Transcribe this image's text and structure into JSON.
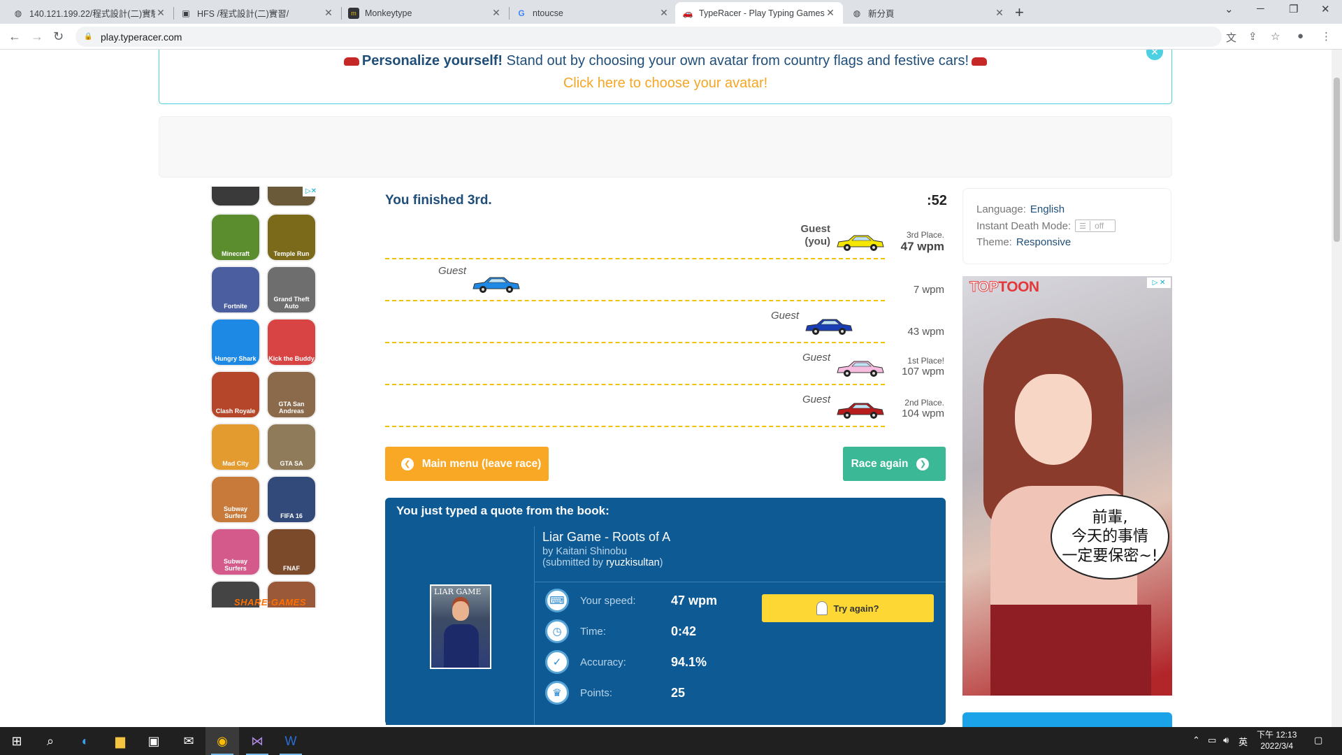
{
  "browser": {
    "tabs": [
      {
        "title": "140.121.199.22/程式設計(二)實驗",
        "icon": "globe-icon"
      },
      {
        "title": "HFS /程式設計(二)實習/",
        "icon": "hfs-icon"
      },
      {
        "title": "Monkeytype",
        "icon": "monkeytype-icon"
      },
      {
        "title": "ntoucse",
        "icon": "google-icon"
      },
      {
        "title": "TypeRacer - Play Typing Games",
        "icon": "typeracer-icon",
        "active": true
      },
      {
        "title": "新分頁",
        "icon": "globe-icon"
      }
    ],
    "url": "play.typeracer.com"
  },
  "banner": {
    "bold": "Personalize yourself!",
    "text": " Stand out by choosing your own avatar from country flags and festive cars!",
    "link": "Click here to choose your avatar!"
  },
  "game_ad": {
    "games": [
      "Minecraft",
      "Temple Run",
      "Fortnite",
      "Grand Theft Auto",
      "Hungry Shark",
      "Kick the Buddy",
      "Clash Royale",
      "GTA San Andreas",
      "Mad City",
      "GTA SA",
      "Subway Surfers",
      "FIFA 16",
      "Subway Surfers",
      "FNAF"
    ],
    "footer": "SHARE·GAMES"
  },
  "race": {
    "finish_message": "You finished 3rd.",
    "timer": ":52",
    "lanes": [
      {
        "name": "Guest",
        "sub": "(you)",
        "you": true,
        "place_label": "3rd Place.",
        "wpm": "47 wpm",
        "car_color": "#f5e600",
        "progress": 1.0
      },
      {
        "name": "Guest",
        "you": false,
        "place_label": "",
        "wpm": "7 wpm",
        "car_color": "#1e88e5",
        "progress": 0.19
      },
      {
        "name": "Guest",
        "you": false,
        "place_label": "",
        "wpm": "43 wpm",
        "car_color": "#1a3fb5",
        "progress": 0.93
      },
      {
        "name": "Guest",
        "you": false,
        "place_label": "1st Place!",
        "wpm": "107 wpm",
        "car_color": "#f6bde0",
        "progress": 1.0
      },
      {
        "name": "Guest",
        "you": false,
        "place_label": "2nd Place.",
        "wpm": "104 wpm",
        "car_color": "#b71c1c",
        "progress": 1.0
      }
    ],
    "main_menu_label": "Main menu (leave race)",
    "race_again_label": "Race again"
  },
  "quote": {
    "header": "You just typed a quote from the book:",
    "cover_text": "LIAR GAME",
    "book_title": "Liar Game - Roots of A",
    "author": "by Kaitani Shinobu",
    "submitted_prefix": "(submitted by ",
    "submitted_by": "ryuzkisultan",
    "submitted_suffix": ")",
    "stats": [
      {
        "label": "Your speed:",
        "value": "47 wpm",
        "icon": "keyboard-icon",
        "glyph": "⌨"
      },
      {
        "label": "Time:",
        "value": "0:42",
        "icon": "clock-icon",
        "glyph": "◷"
      },
      {
        "label": "Accuracy:",
        "value": "94.1%",
        "icon": "check-icon",
        "glyph": "✓"
      },
      {
        "label": "Points:",
        "value": "25",
        "icon": "trophy-icon",
        "glyph": "♛"
      }
    ],
    "try_again_label": "Try again?"
  },
  "settings": {
    "language_label": "Language:",
    "language_value": "English",
    "instant_death_label": "Instant Death Mode:",
    "instant_death_value": "off",
    "theme_label": "Theme:",
    "theme_value": "Responsive"
  },
  "comic_ad": {
    "logo_a": "TOP",
    "logo_b": "TOON",
    "speech": [
      "前輩,",
      "今天的事情",
      "一定要保密~!"
    ]
  },
  "taskbar": {
    "ime": "英",
    "time": "下午 12:13",
    "date": "2022/3/4"
  },
  "colors": {
    "accent_orange": "#f9a825",
    "accent_green": "#3bb896",
    "quote_blue": "#0e5a94",
    "title_blue": "#1f4e79"
  }
}
